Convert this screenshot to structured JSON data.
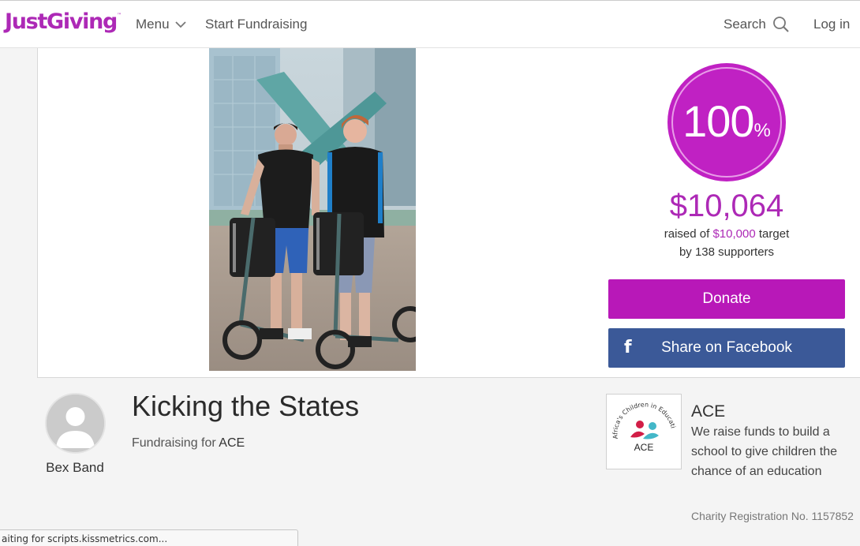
{
  "header": {
    "logo": "JustGiving",
    "logo_tm": "™",
    "menu_label": "Menu",
    "start_label": "Start Fundraising",
    "search_label": "Search",
    "login_label": "Log in"
  },
  "campaign": {
    "percent": "100",
    "percent_sign": "%",
    "progress_fraction": 1.0,
    "raised": "$10,064",
    "raised_prefix": "raised of",
    "target": "$10,000",
    "target_suffix": "target",
    "supporters_prefix": "by",
    "supporters": "138 supporters"
  },
  "actions": {
    "donate_label": "Donate",
    "facebook_icon": "f",
    "facebook_label": "Share on Facebook"
  },
  "page": {
    "owner": "Bex Band",
    "title": "Kicking the States",
    "fundraising_prefix": "Fundraising for",
    "charity_short": "ACE"
  },
  "charity": {
    "name": "ACE",
    "logo_arc_text": "Africa's Children in Education",
    "logo_text": "ACE",
    "description": "We raise funds to build a school to give children the chance of an education",
    "registration": "Charity Registration No. 1157852"
  },
  "status": {
    "text": "aiting for scripts.kissmetrics.com..."
  },
  "colors": {
    "brand": "#ad29b6",
    "donate": "#b818b8",
    "facebook": "#3b5998"
  },
  "icons": {
    "menu": "chevron-down-icon",
    "search": "search-icon",
    "facebook": "facebook-icon",
    "avatar": "user-icon"
  }
}
